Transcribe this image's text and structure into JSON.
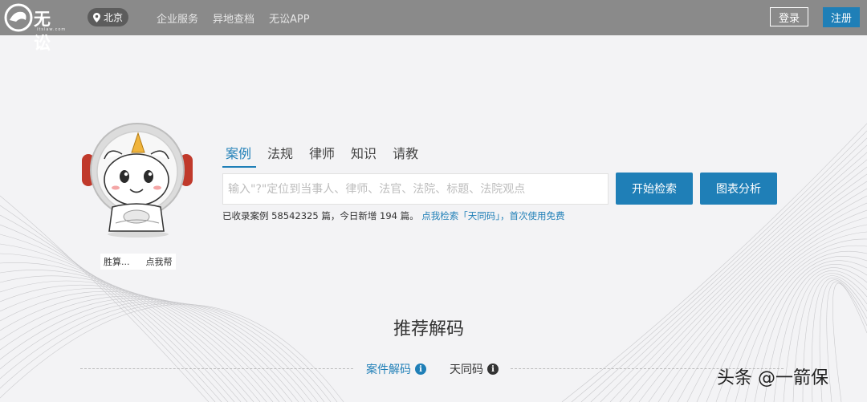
{
  "header": {
    "logo_text": "无讼",
    "logo_sub": "itslaw.com",
    "city": "北京",
    "nav": [
      "企业服务",
      "异地查档",
      "无讼APP"
    ],
    "login_label": "登录",
    "register_label": "注册"
  },
  "mascot": {
    "caption_left": "胜算...",
    "caption_right": "点我帮"
  },
  "search": {
    "tabs": [
      {
        "label": "案例",
        "active": true
      },
      {
        "label": "法规",
        "active": false
      },
      {
        "label": "律师",
        "active": false
      },
      {
        "label": "知识",
        "active": false
      },
      {
        "label": "请教",
        "active": false
      }
    ],
    "placeholder": "输入\"?\"定位到当事人、律师、法官、法院、标题、法院观点",
    "search_button": "开始检索",
    "chart_button": "图表分析",
    "stats_prefix": "已收录案例 58542325 篇，今日新增 194 篇。",
    "stats_link": "点我检索「天同码」，首次使用免费"
  },
  "recommend": {
    "title": "推荐解码",
    "tabs": [
      {
        "label": "案件解码",
        "active": true
      },
      {
        "label": "天同码",
        "active": false
      }
    ]
  },
  "watermark": "头条 @一箭保",
  "colors": {
    "accent": "#1f7fb7",
    "topbar": "#8a8a8a"
  }
}
